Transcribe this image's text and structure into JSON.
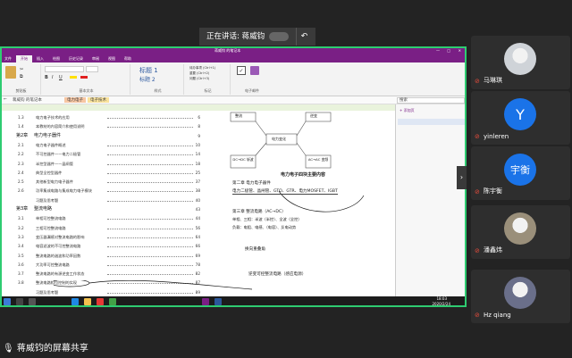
{
  "meeting": {
    "speaking_label": "正在讲话: 蒋威钧",
    "share_label": "蒋威钧的屏幕共享"
  },
  "onenote": {
    "title": "蒋威钧 的笔记本",
    "ribbon_tabs": [
      "文件",
      "开始",
      "插入",
      "绘图",
      "历史记录",
      "审阅",
      "视图",
      "帮助"
    ],
    "active_tab": "开始",
    "groups": [
      "剪贴板",
      "基本文本",
      "样式",
      "标记",
      "电子邮件"
    ],
    "style_items": [
      "标题 1",
      "标题 2"
    ],
    "tag_items": [
      "待办事项 (Ctrl+1)",
      "重要 (Ctrl+2)",
      "问题 (Ctrl+3)"
    ],
    "notebook_name": "蒋威钧 的笔记本",
    "section_tabs": [
      "电力电子",
      "电子技术"
    ],
    "search_placeholder": "搜索",
    "add_page": "+ 添加页"
  },
  "toc": [
    {
      "num": "1.3",
      "text": "电力电子技术的应用",
      "page": "6",
      "chap": false
    },
    {
      "num": "1.4",
      "text": "本教材的内容简介和使用说明",
      "page": "8",
      "chap": false
    },
    {
      "num": "第2章",
      "text": "电力电子器件",
      "page": "9",
      "chap": true
    },
    {
      "num": "2.1",
      "text": "电力电子器件概述",
      "page": "10",
      "chap": false
    },
    {
      "num": "2.2",
      "text": "不可控器件——电力二极管",
      "page": "14",
      "chap": false
    },
    {
      "num": "2.3",
      "text": "半控型器件——晶闸管",
      "page": "18",
      "chap": false
    },
    {
      "num": "2.4",
      "text": "典型全控型器件",
      "page": "25",
      "chap": false
    },
    {
      "num": "2.5",
      "text": "其他新型电力电子器件",
      "page": "37",
      "chap": false
    },
    {
      "num": "2.6",
      "text": "功率集成电路与集成电力电子模块",
      "page": "38",
      "chap": false
    },
    {
      "num": "",
      "text": "习题及思考题",
      "page": "40",
      "chap": false
    },
    {
      "num": "第3章",
      "text": "整流电路",
      "page": "43",
      "chap": true
    },
    {
      "num": "3.1",
      "text": "单相可控整流电路",
      "page": "44",
      "chap": false
    },
    {
      "num": "3.2",
      "text": "三相可控整流电路",
      "page": "56",
      "chap": false
    },
    {
      "num": "3.3",
      "text": "变压器漏感对整流电路的影响",
      "page": "64",
      "chap": false
    },
    {
      "num": "3.4",
      "text": "电容滤波的不可控整流电路",
      "page": "66",
      "chap": false
    },
    {
      "num": "3.5",
      "text": "整流电路的谐波和功率因数",
      "page": "69",
      "chap": false
    },
    {
      "num": "3.6",
      "text": "大功率可控整流电路",
      "page": "78",
      "chap": false
    },
    {
      "num": "3.7",
      "text": "整流电路的有源逆变工作状态",
      "page": "82",
      "chap": false
    },
    {
      "num": "3.8",
      "text": "整流电路相位控制的实现",
      "page": "87",
      "chap": false
    },
    {
      "num": "",
      "text": "习题及思考题",
      "page": "89",
      "chap": false
    }
  ],
  "notes": {
    "diagram_center": "电力变化",
    "box_left_top": "整流",
    "box_right_top": "逆变",
    "box_left_bottom": "DC→DC 斩波",
    "box_right_bottom": "AC→AC 变频",
    "diagram_caption": "电力电子四块主要内容",
    "chapter2_title": "第二章  电力电子器件",
    "chapter2_body": "电力二极管、晶闸管、GTO、GTR、电力MOSFET、IGBT",
    "chapter3_title": "第三章  整流电路（AC→DC）",
    "chapter3_line1": "单相、三相：半波（半控）、全波（全控）",
    "chapter3_line2": "负载：电阻、电感、（电容）、反电动势",
    "annot1": "换向重叠角",
    "annot2": "逆变可控整流电路（感应电源）"
  },
  "taskbar": {
    "time": "18:03",
    "date": "2020/2/24"
  },
  "participants": [
    {
      "name": "马琳琪",
      "initial": "",
      "color": "#cfd3d8",
      "type": "photo"
    },
    {
      "name": "yinleren",
      "initial": "Y",
      "color": "#1a73e8",
      "type": "letter"
    },
    {
      "name": "陈宇衡",
      "initial": "宇衡",
      "color": "#1a73e8",
      "type": "letter"
    },
    {
      "name": "潘鑫炜",
      "initial": "",
      "color": "#9a8f7a",
      "type": "photo"
    },
    {
      "name": "Hz qiang",
      "initial": "",
      "color": "#6a6f8a",
      "type": "photo"
    }
  ]
}
